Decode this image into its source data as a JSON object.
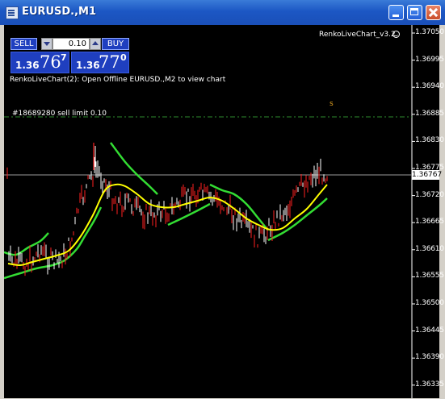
{
  "window": {
    "title": "EURUSD.,M1"
  },
  "trade_panel": {
    "sell_label": "SELL",
    "buy_label": "BUY",
    "lot_value": "0.10",
    "sell_small": "1.36",
    "sell_big": "76",
    "sell_sup": "7",
    "buy_small": "1.36",
    "buy_big": "77",
    "buy_sup": "0"
  },
  "chart": {
    "ea_name": "RenkoLiveChart_v3.2",
    "info_text": "RenkoLiveChart(2): Open Offline EURUSD.,M2 to view chart",
    "order_label": "#18689280 sell limit 0.10",
    "marker": "s",
    "current_price": "1.36767",
    "price_labels": [
      "1.37050",
      "1.36995",
      "1.36940",
      "1.36885",
      "1.36830",
      "1.36775",
      "1.36720",
      "1.36665",
      "1.36610",
      "1.36555",
      "1.36500",
      "1.36445",
      "1.36390",
      "1.36335"
    ],
    "colors": {
      "background": "#000000",
      "bull_candle": "#ffffff",
      "bear_candle": "#ff2020",
      "ma_yellow": "#ffff00",
      "band_green": "#33dd33",
      "order_line": "#2e8b2e"
    }
  }
}
